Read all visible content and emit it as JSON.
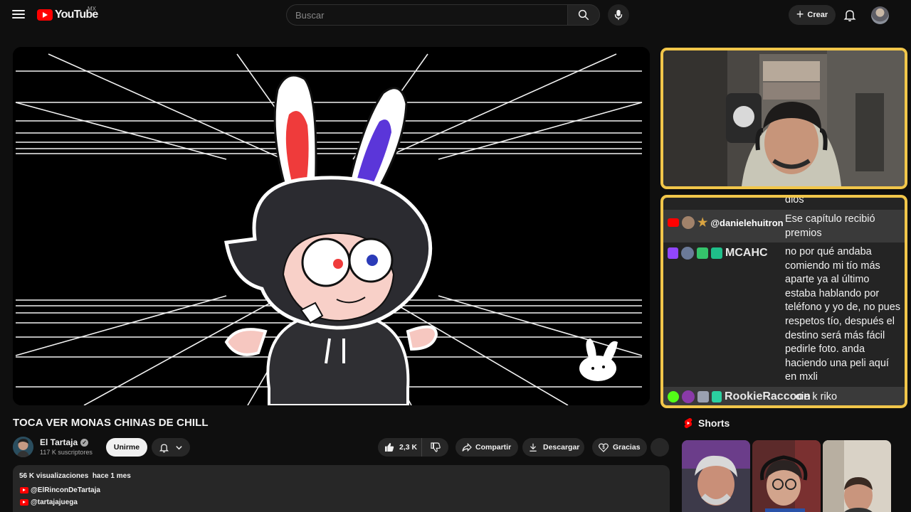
{
  "header": {
    "logo_text": "YouTube",
    "country_code": "MX",
    "search_placeholder": "Buscar",
    "create_label": "Crear"
  },
  "chat": {
    "partial_top_text": "dios",
    "messages": [
      {
        "platform": "youtube",
        "user": "@danielehuitron",
        "text": "Ese capítulo recibió premios"
      },
      {
        "platform": "twitch",
        "user": "MCAHC",
        "text": "no por qué andaba comiendo mi tío más aparte ya al último estaba hablando por teléfono y yo de, no pues respetos tío, después el destino será más fácil pedirle foto. anda haciendo una peli aquí en mxli"
      },
      {
        "platform": "kick",
        "user": "RookieRaccoon",
        "text": "oie k riko"
      }
    ]
  },
  "video": {
    "title": "TOCA VER MONAS CHINAS DE CHILL",
    "channel": "El Tartaja",
    "subscribers": "117 K suscriptores",
    "join_label": "Unirme",
    "likes": "2,3 K",
    "share_label": "Compartir",
    "download_label": "Descargar",
    "thanks_label": "Gracias"
  },
  "description": {
    "stats": "56 K visualizaciones  hace 1 mes",
    "links": [
      "@ElRinconDeTartaja",
      "@tartajajuega"
    ]
  },
  "shorts": {
    "heading": "Shorts"
  },
  "colors": {
    "accent": "#ff0000",
    "stream_border": "#f1c64a",
    "background": "#0f0f0f"
  }
}
